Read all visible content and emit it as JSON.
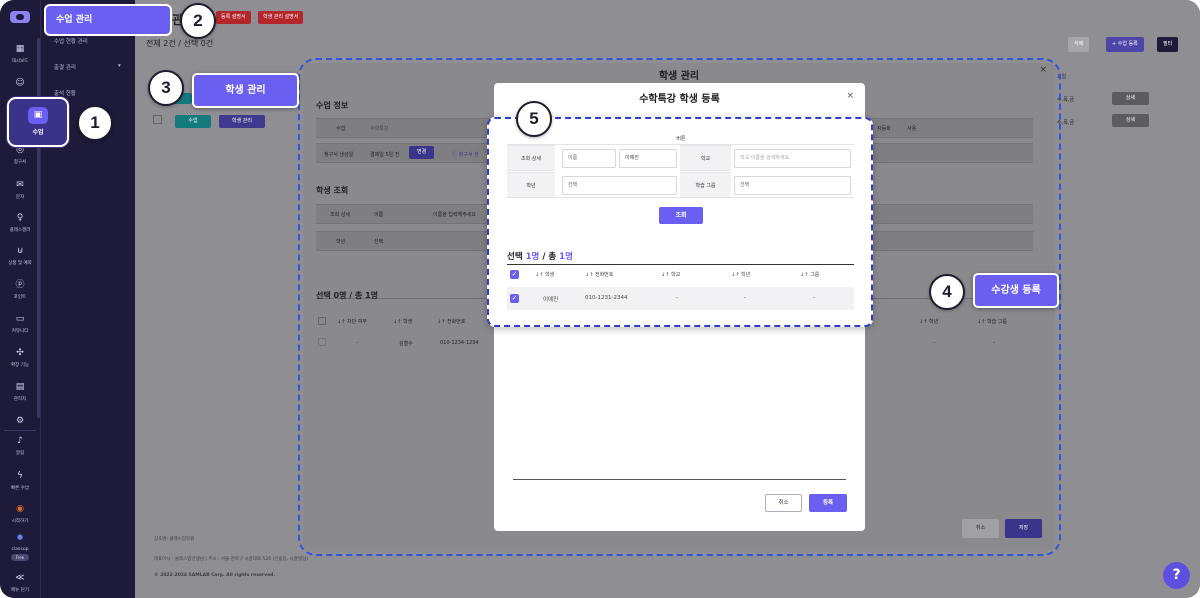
{
  "sidebar": {
    "items": [
      {
        "icon": "grid-icon",
        "glyph": "▦",
        "label": "대시보드"
      },
      {
        "icon": "users-icon",
        "glyph": "☺",
        "label": ""
      },
      {
        "icon": "calendar-icon",
        "glyph": "▣",
        "label": "수업"
      },
      {
        "icon": "billing-icon",
        "glyph": "◎",
        "label": "청구서"
      },
      {
        "icon": "mail-icon",
        "glyph": "✉",
        "label": "문자"
      },
      {
        "icon": "class-icon",
        "glyph": "♀",
        "label": "클래스갤러"
      },
      {
        "icon": "bag-icon",
        "glyph": "⊍",
        "label": "상품 및 예약"
      },
      {
        "icon": "point-icon",
        "glyph": "ⓟ",
        "label": "포인트"
      },
      {
        "icon": "chat-icon",
        "glyph": "▭",
        "label": "커뮤니티"
      },
      {
        "icon": "puzzle-icon",
        "glyph": "✣",
        "label": "확장 기능"
      },
      {
        "icon": "admin-icon",
        "glyph": "▤",
        "label": "관리자"
      },
      {
        "icon": "gear-icon",
        "glyph": "⚙",
        "label": ""
      },
      {
        "icon": "bell-icon",
        "glyph": "♪",
        "label": "알림"
      },
      {
        "icon": "bolt-icon",
        "glyph": "ϟ",
        "label": "빠른 수납"
      },
      {
        "icon": "start-icon",
        "glyph": "◉",
        "label": "시작하기"
      },
      {
        "icon": "classup-icon",
        "glyph": "●",
        "label": "classup"
      },
      {
        "icon": "collapse-icon",
        "glyph": "≪",
        "label": "메뉴 닫기"
      }
    ],
    "plan_badge": "Free"
  },
  "submenu": {
    "active_label": "수업 관리",
    "items": [
      "수업 현황 관리",
      "출결 관리",
      "출석 현황"
    ]
  },
  "header": {
    "title_partial": "관",
    "btn_register_guide": "등록 설명서",
    "btn_manage_guide": "학생 관리 설명서",
    "count_line": "전체 2건 / 선택 0건",
    "btn_delete": "삭제",
    "btn_add_class": "+ 수업 등록",
    "btn_filter": "필터",
    "col_days": "요일",
    "rows_days": [
      "수,목,금",
      "수,목,금"
    ],
    "btn_detail": "상세"
  },
  "student_modal": {
    "title": "학생 관리",
    "section_class": "수업 정보",
    "class_label": "수업",
    "class_value": "수학특강",
    "status_label": "자동화",
    "status_value": "사용",
    "billing_label": "청구서 생성일",
    "billing_value": "결제일 5일 전",
    "btn_change": "변경",
    "billing_help": "청구서 생",
    "section_search": "학생 조회",
    "search_label": "조회 상세",
    "search_option": "이름",
    "search_placeholder": "이름을 입력해주세요",
    "grade_label": "학년",
    "grade_value": "선택",
    "sel_line": "선택 0명 / 총 1명",
    "cols": [
      "차단 여부",
      "학생",
      "전화번호",
      "학년",
      "학습 그룹"
    ],
    "row": {
      "block": "-",
      "student": "김철수",
      "phone": "010-1234-1234",
      "grade": "-",
      "group": "-"
    },
    "btn_cancel": "취소",
    "btn_save": "저장",
    "btn_class": "수업",
    "btn_student_manage": "학생 관리"
  },
  "register_modal": {
    "title": "수학특강 학생 등록",
    "sub_label": "버튼",
    "search_detail_label": "조회 상세",
    "search_option": "이름",
    "search_value": "이예진",
    "school_label": "학교",
    "school_placeholder": "학교 이름을 검색하세요.",
    "grade_label": "학년",
    "grade_value": "선택",
    "group_label": "학습 그룹",
    "group_value": "선택",
    "search_button": "조회",
    "selection_prefix": "선택 ",
    "selection_selected": "1명",
    "selection_middle": " / 총 ",
    "selection_total": "1명",
    "columns": [
      "학생",
      "전화번호",
      "학교",
      "학년",
      "그룹"
    ],
    "rows": [
      {
        "student": "이예진",
        "phone": "010-1231-2344",
        "school": "-",
        "grade": "-",
        "group": "-"
      }
    ],
    "btn_cancel": "취소",
    "btn_register": "등록"
  },
  "callouts": {
    "student_manage": "학생 관리",
    "enroll": "수강생 등록"
  },
  "badges": [
    "1",
    "2",
    "3",
    "4",
    "5"
  ],
  "footer": {
    "line1": "상호명: 클래스업학원",
    "line2": "대표이사 : 클래스업선생님  |  주소 : 서울 관악구 시흥대로 526 (신림동, 시흥빌딩)",
    "line3": "© 2022-2024 SAMLAB Corp. All rights reserved."
  },
  "help_glyph": "?",
  "colors": {
    "accent": "#6a5ff0",
    "sidebar": "#1e1b3a",
    "danger": "#b3262b",
    "highlight_border": "#2f54e0"
  }
}
